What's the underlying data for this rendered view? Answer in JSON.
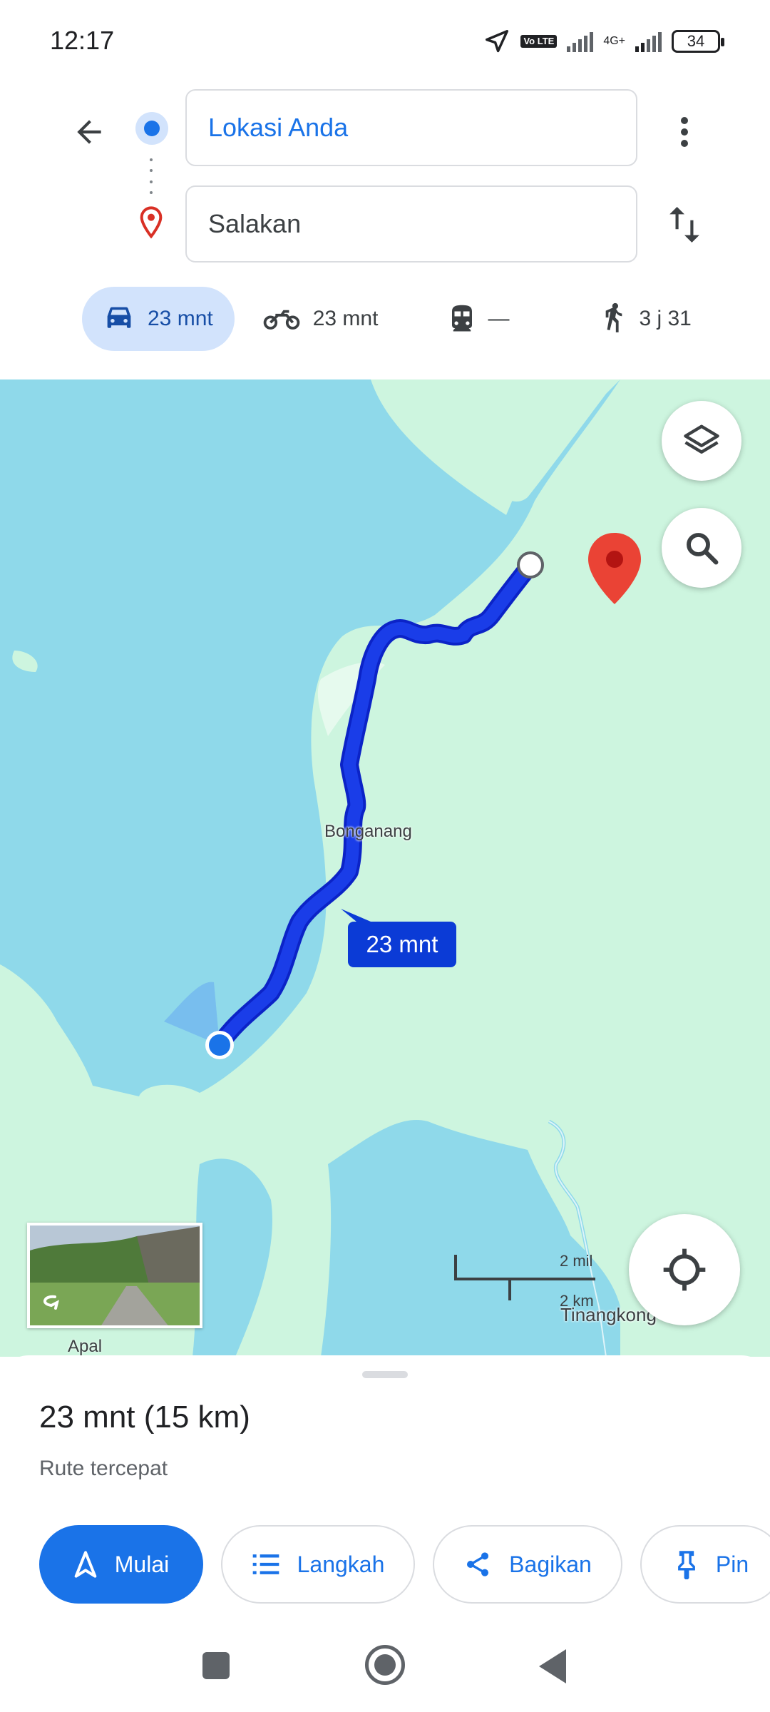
{
  "status_bar": {
    "time": "12:17",
    "network": "4G+",
    "lte_badge": "Vo LTE",
    "battery": "34"
  },
  "directions": {
    "origin": "Lokasi Anda",
    "destination": "Salakan",
    "modes": [
      {
        "icon": "car-icon",
        "label": "23 mnt",
        "selected": true
      },
      {
        "icon": "motorcycle-icon",
        "label": "23 mnt",
        "selected": false
      },
      {
        "icon": "transit-icon",
        "label": "—",
        "selected": false
      },
      {
        "icon": "walk-icon",
        "label": "3 j 31",
        "selected": false
      }
    ]
  },
  "map": {
    "place_labels": {
      "bonganang": "Bonganang",
      "tinangkong": "Tinangkong"
    },
    "route_eta": "23 mnt",
    "scale": {
      "miles": "2 mil",
      "km": "2 km"
    },
    "streetview_label": "Apal",
    "colors": {
      "water": "#8fd9ea",
      "land": "#cdf5df",
      "route": "#1a3de8",
      "pin": "#ea4335"
    }
  },
  "route": {
    "summary": "23 mnt (15 km)",
    "subtitle": "Rute tercepat"
  },
  "actions": {
    "start": "Mulai",
    "steps": "Langkah",
    "share": "Bagikan",
    "pin": "Pin"
  }
}
